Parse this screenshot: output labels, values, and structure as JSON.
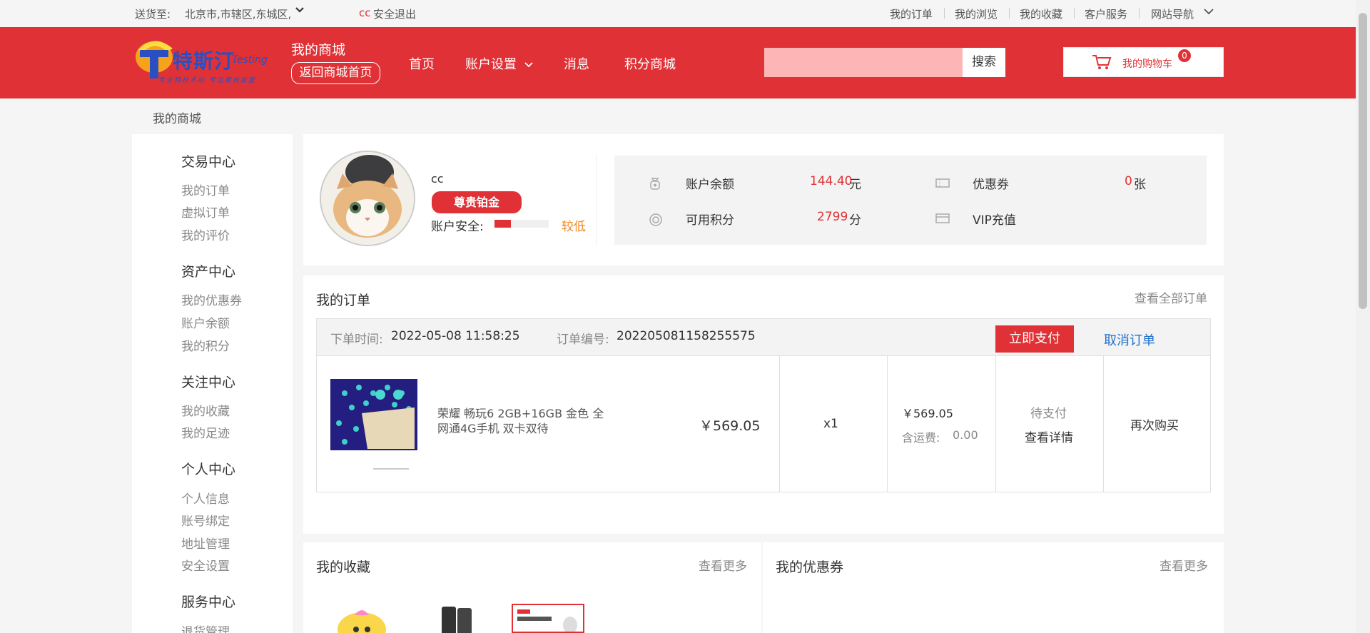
{
  "topbar": {
    "deliver_label": "送货至:",
    "location": "北京市,市辖区,东城区,",
    "user": "cc",
    "logout": "安全退出",
    "links": [
      "我的订单",
      "我的浏览",
      "我的收藏",
      "客户服务",
      "网站导航"
    ]
  },
  "header": {
    "logo_text": "特斯汀",
    "logo_sub": "Testing",
    "logo_slogan": "专业特技术站 专注建技能量",
    "my_mall": "我的商城",
    "back_home": "返回商城首页",
    "nav": [
      "首页",
      "账户设置",
      "消息",
      "积分商城"
    ],
    "search_button": "搜索",
    "search_placeholder": "",
    "cart_label": "我的购物车",
    "cart_count": "0"
  },
  "breadcrumb": "我的商城",
  "sidebar": {
    "sections": [
      {
        "title": "交易中心",
        "items": [
          "我的订单",
          "虚拟订单",
          "我的评价"
        ]
      },
      {
        "title": "资产中心",
        "items": [
          "我的优惠券",
          "账户余额",
          "我的积分"
        ]
      },
      {
        "title": "关注中心",
        "items": [
          "我的收藏",
          "我的足迹"
        ]
      },
      {
        "title": "个人中心",
        "items": [
          "个人信息",
          "账号绑定",
          "地址管理",
          "安全设置"
        ]
      },
      {
        "title": "服务中心",
        "items": [
          "退货管理"
        ]
      }
    ]
  },
  "profile": {
    "username": "cc",
    "level": "尊贵铂金",
    "security_label": "账户安全:",
    "security_level": "较低",
    "security_fraction": 0.3,
    "balance_label": "账户余额",
    "balance_value": "144.40",
    "balance_unit": "元",
    "coupon_label": "优惠券",
    "coupon_value": "0",
    "coupon_unit": "张",
    "points_label": "可用积分",
    "points_value": "2799",
    "points_unit": "分",
    "vip_label": "VIP充值"
  },
  "orders": {
    "title": "我的订单",
    "view_all": "查看全部订单",
    "order_time_label": "下单时间:",
    "order_time": "2022-05-08 11:58:25",
    "order_no_label": "订单编号:",
    "order_no": "202205081158255575",
    "pay_button": "立即支付",
    "cancel_button": "取消订单",
    "product_name_line1": "荣耀 畅玩6 2GB+16GB 金色 全",
    "product_name_line2": "网通4G手机 双卡双待",
    "unit_price": "￥569.05",
    "quantity": "x1",
    "total": "￥569.05",
    "shipping_label": "含运费:",
    "shipping_value": "0.00",
    "status": "待支付",
    "view_detail": "查看详情",
    "buy_again": "再次购买"
  },
  "favorites": {
    "title": "我的收藏",
    "more": "查看更多"
  },
  "coupons": {
    "title": "我的优惠券",
    "more": "查看更多"
  },
  "colors": {
    "brand_red": "#e03236",
    "search_pink": "#feb5b5"
  }
}
